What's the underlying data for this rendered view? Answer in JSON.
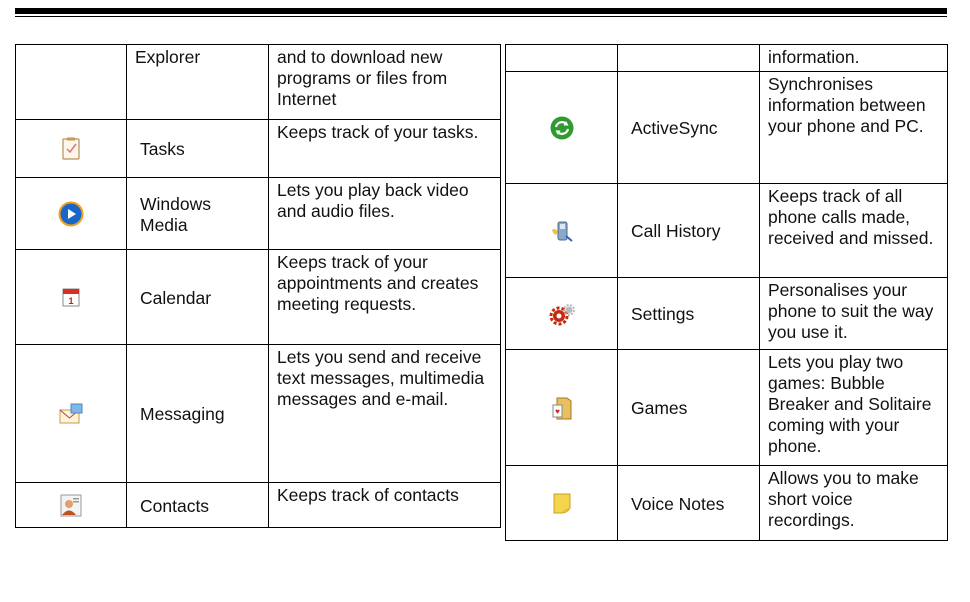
{
  "left_table": {
    "rows": [
      {
        "icon": "",
        "name": "Explorer",
        "description": "and to download new programs or files from Internet"
      },
      {
        "icon": "tasks-icon",
        "name": "Tasks",
        "description": "Keeps track of your tasks."
      },
      {
        "icon": "windows-media-icon",
        "name": "Windows Media",
        "description": "Lets you play back video and audio files."
      },
      {
        "icon": "calendar-icon",
        "name": "Calendar",
        "description": "Keeps track of your appointments and creates meeting requests."
      },
      {
        "icon": "messaging-icon",
        "name": "Messaging",
        "description": "Lets you send and receive text messages, multimedia messages and e-mail."
      },
      {
        "icon": "contacts-icon",
        "name": "Contacts",
        "description": "Keeps track of contacts"
      }
    ]
  },
  "right_table": {
    "rows": [
      {
        "icon": "",
        "name": "",
        "description": "information."
      },
      {
        "icon": "activesync-icon",
        "name": "ActiveSync",
        "description": "Synchronises information between your phone and PC."
      },
      {
        "icon": "call-history-icon",
        "name": "Call History",
        "description": "Keeps track of all phone calls made, received and missed."
      },
      {
        "icon": "settings-icon",
        "name": "Settings",
        "description": "Personalises your phone to suit the way you use it."
      },
      {
        "icon": "games-icon",
        "name": "Games",
        "description": "Lets you play two games: Bubble Breaker and Solitaire coming with your phone."
      },
      {
        "icon": "voice-notes-icon",
        "name": "Voice Notes",
        "description": "Allows you to make short voice recordings."
      }
    ]
  }
}
